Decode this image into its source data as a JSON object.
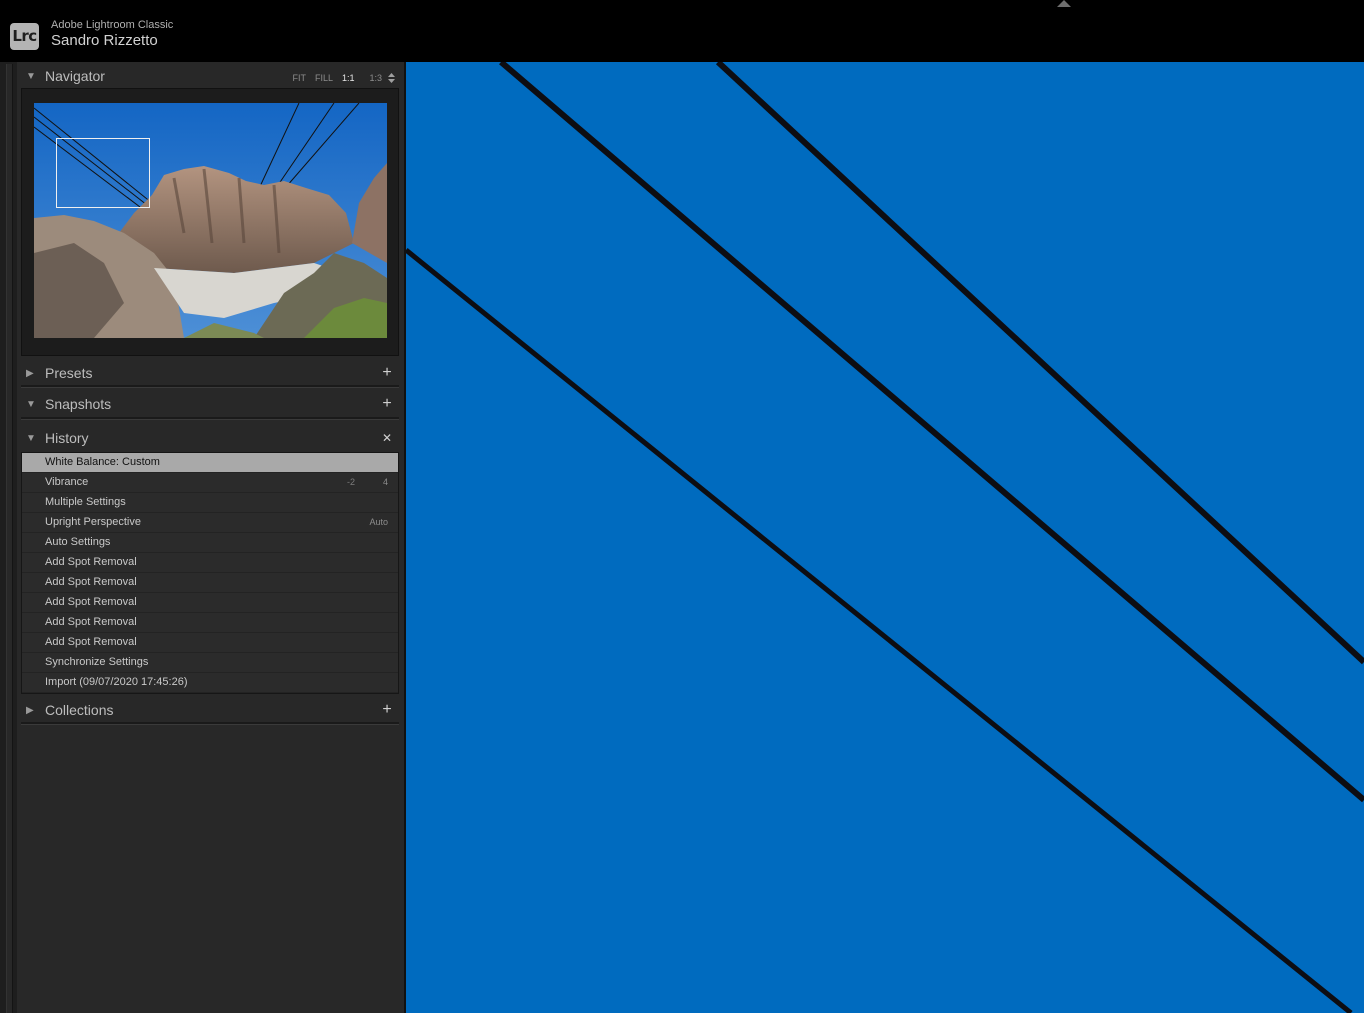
{
  "app": {
    "logo_text": "Lrc",
    "name": "Adobe Lightroom Classic",
    "user": "Sandro Rizzetto"
  },
  "navigator": {
    "title": "Navigator",
    "zoom_options": [
      "FIT",
      "FILL",
      "1:1",
      "1:3"
    ],
    "zoom_selected": "1:1"
  },
  "presets": {
    "title": "Presets",
    "action": "+"
  },
  "snapshots": {
    "title": "Snapshots",
    "action": "+"
  },
  "history": {
    "title": "History",
    "action": "✕",
    "items": [
      {
        "label": "White Balance: Custom",
        "v1": "",
        "v2": "",
        "selected": true
      },
      {
        "label": "Vibrance",
        "v1": "-2",
        "v2": "4",
        "selected": false
      },
      {
        "label": "Multiple Settings",
        "v1": "",
        "v2": "",
        "selected": false
      },
      {
        "label": "Upright Perspective",
        "v1": "",
        "v2": "Auto",
        "selected": false
      },
      {
        "label": "Auto Settings",
        "v1": "",
        "v2": "",
        "selected": false
      },
      {
        "label": "Add Spot Removal",
        "v1": "",
        "v2": "",
        "selected": false
      },
      {
        "label": "Add Spot Removal",
        "v1": "",
        "v2": "",
        "selected": false
      },
      {
        "label": "Add Spot Removal",
        "v1": "",
        "v2": "",
        "selected": false
      },
      {
        "label": "Add Spot Removal",
        "v1": "",
        "v2": "",
        "selected": false
      },
      {
        "label": "Add Spot Removal",
        "v1": "",
        "v2": "",
        "selected": false
      },
      {
        "label": "Synchronize Settings",
        "v1": "",
        "v2": "",
        "selected": false
      },
      {
        "label": "Import (09/07/2020 17:45:26)",
        "v1": "",
        "v2": "",
        "selected": false
      }
    ]
  },
  "collections": {
    "title": "Collections",
    "action": "+"
  },
  "colors": {
    "sky_blue": "#006bbf",
    "panel_bg": "#282828",
    "selected_row": "#a9a9a9"
  }
}
